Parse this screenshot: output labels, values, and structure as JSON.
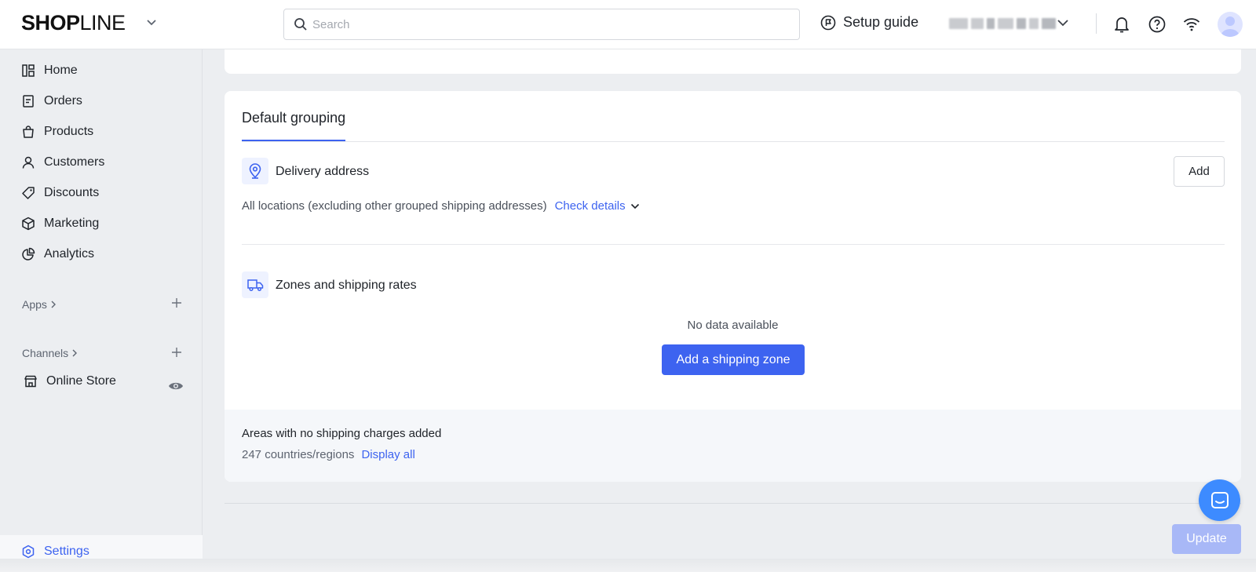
{
  "header": {
    "logo_part1": "SHOP",
    "logo_part2": "LINE",
    "search_placeholder": "Search",
    "setup_guide_label": "Setup guide"
  },
  "sidebar": {
    "items": [
      {
        "label": "Home",
        "icon": "home-icon"
      },
      {
        "label": "Orders",
        "icon": "orders-icon"
      },
      {
        "label": "Products",
        "icon": "bag-icon"
      },
      {
        "label": "Customers",
        "icon": "person-icon"
      },
      {
        "label": "Discounts",
        "icon": "tag-icon"
      },
      {
        "label": "Marketing",
        "icon": "cube-icon"
      },
      {
        "label": "Analytics",
        "icon": "pie-chart-icon"
      }
    ],
    "apps_label": "Apps",
    "channels_label": "Channels",
    "online_store_label": "Online Store",
    "settings_label": "Settings"
  },
  "main": {
    "tab_label": "Default grouping",
    "delivery_address_title": "Delivery address",
    "add_button_label": "Add",
    "locations_text": "All locations (excluding other grouped shipping addresses)",
    "check_details_label": "Check details",
    "zones_title": "Zones and shipping rates",
    "no_data_text": "No data available",
    "add_zone_button_label": "Add a shipping zone",
    "areas_title": "Areas with no shipping charges added",
    "areas_count_text": "247 countries/regions",
    "display_all_label": "Display all",
    "update_button_label": "Update"
  },
  "colors": {
    "accent": "#3d63f0",
    "update_disabled": "#a8b8f7",
    "chat": "#3d8bff"
  }
}
